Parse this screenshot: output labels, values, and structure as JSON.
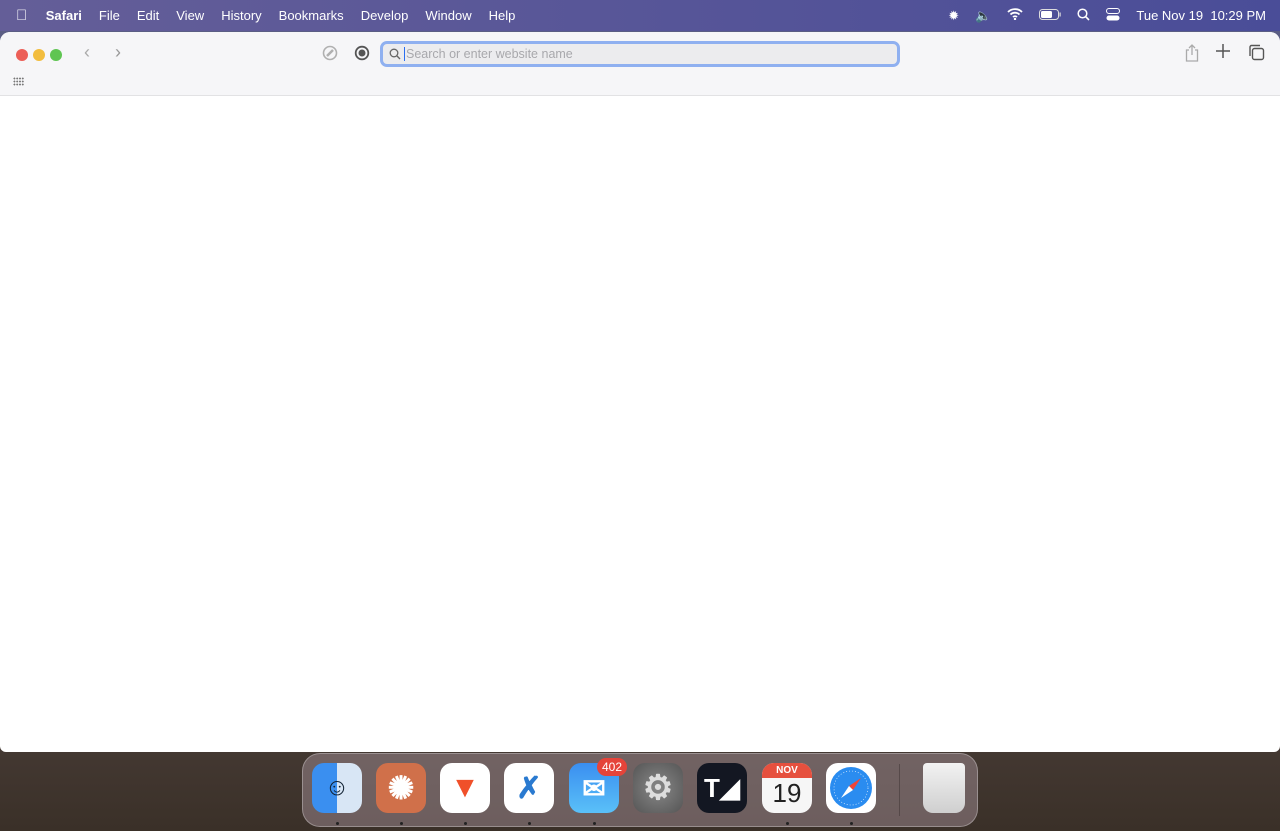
{
  "menubar": {
    "app": "Safari",
    "items": [
      "File",
      "Edit",
      "View",
      "History",
      "Bookmarks",
      "Develop",
      "Window",
      "Help"
    ],
    "date": "Tue Nov 19",
    "time": "10:29 PM"
  },
  "toolbar": {
    "address_placeholder": "Search or enter website name"
  },
  "dock": {
    "apps": [
      "Finder",
      "Perplexity",
      "Brave Browser",
      "Visual Studio Code",
      "Mail",
      "System Settings",
      "TradingView",
      "Calendar",
      "Safari",
      "Trash"
    ],
    "mail_badge": "402",
    "calendar_month": "NOV",
    "calendar_day": "19"
  }
}
